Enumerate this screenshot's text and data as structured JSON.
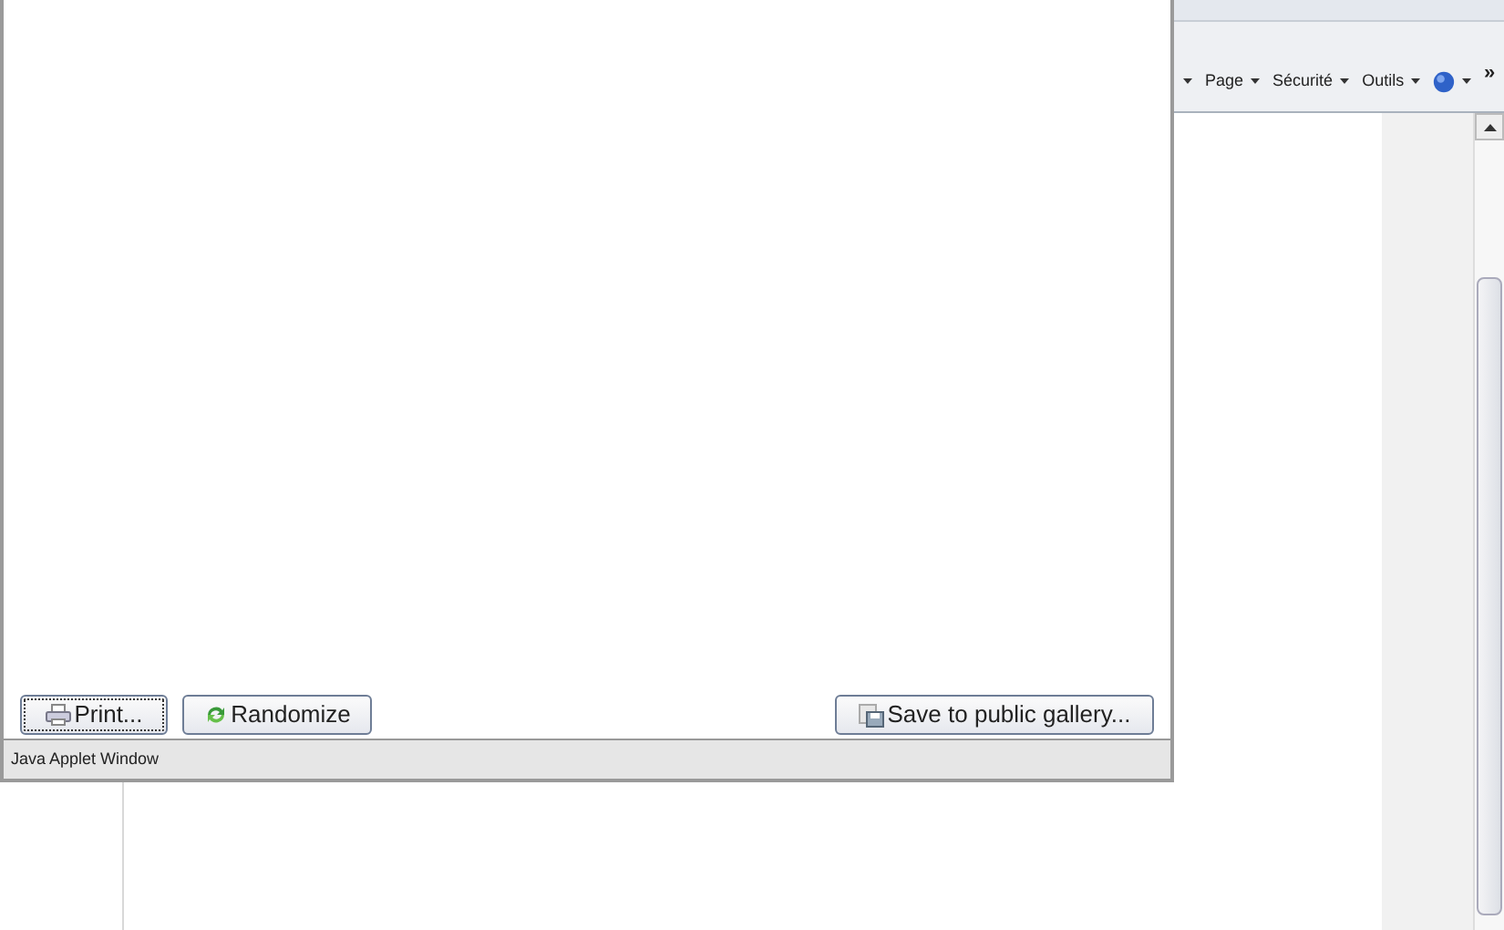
{
  "browser": {
    "menus": [
      {
        "label": "Page"
      },
      {
        "label": "Sécurité"
      },
      {
        "label": "Outils"
      }
    ],
    "overflow": "»"
  },
  "applet": {
    "buttons": [
      {
        "label": "Print...",
        "kind": "print",
        "focused": true
      },
      {
        "label": "Randomize",
        "kind": "randomize",
        "focused": false
      },
      {
        "label": "Save to public gallery...",
        "kind": "save",
        "focused": false
      }
    ],
    "status": "Java Applet Window"
  }
}
